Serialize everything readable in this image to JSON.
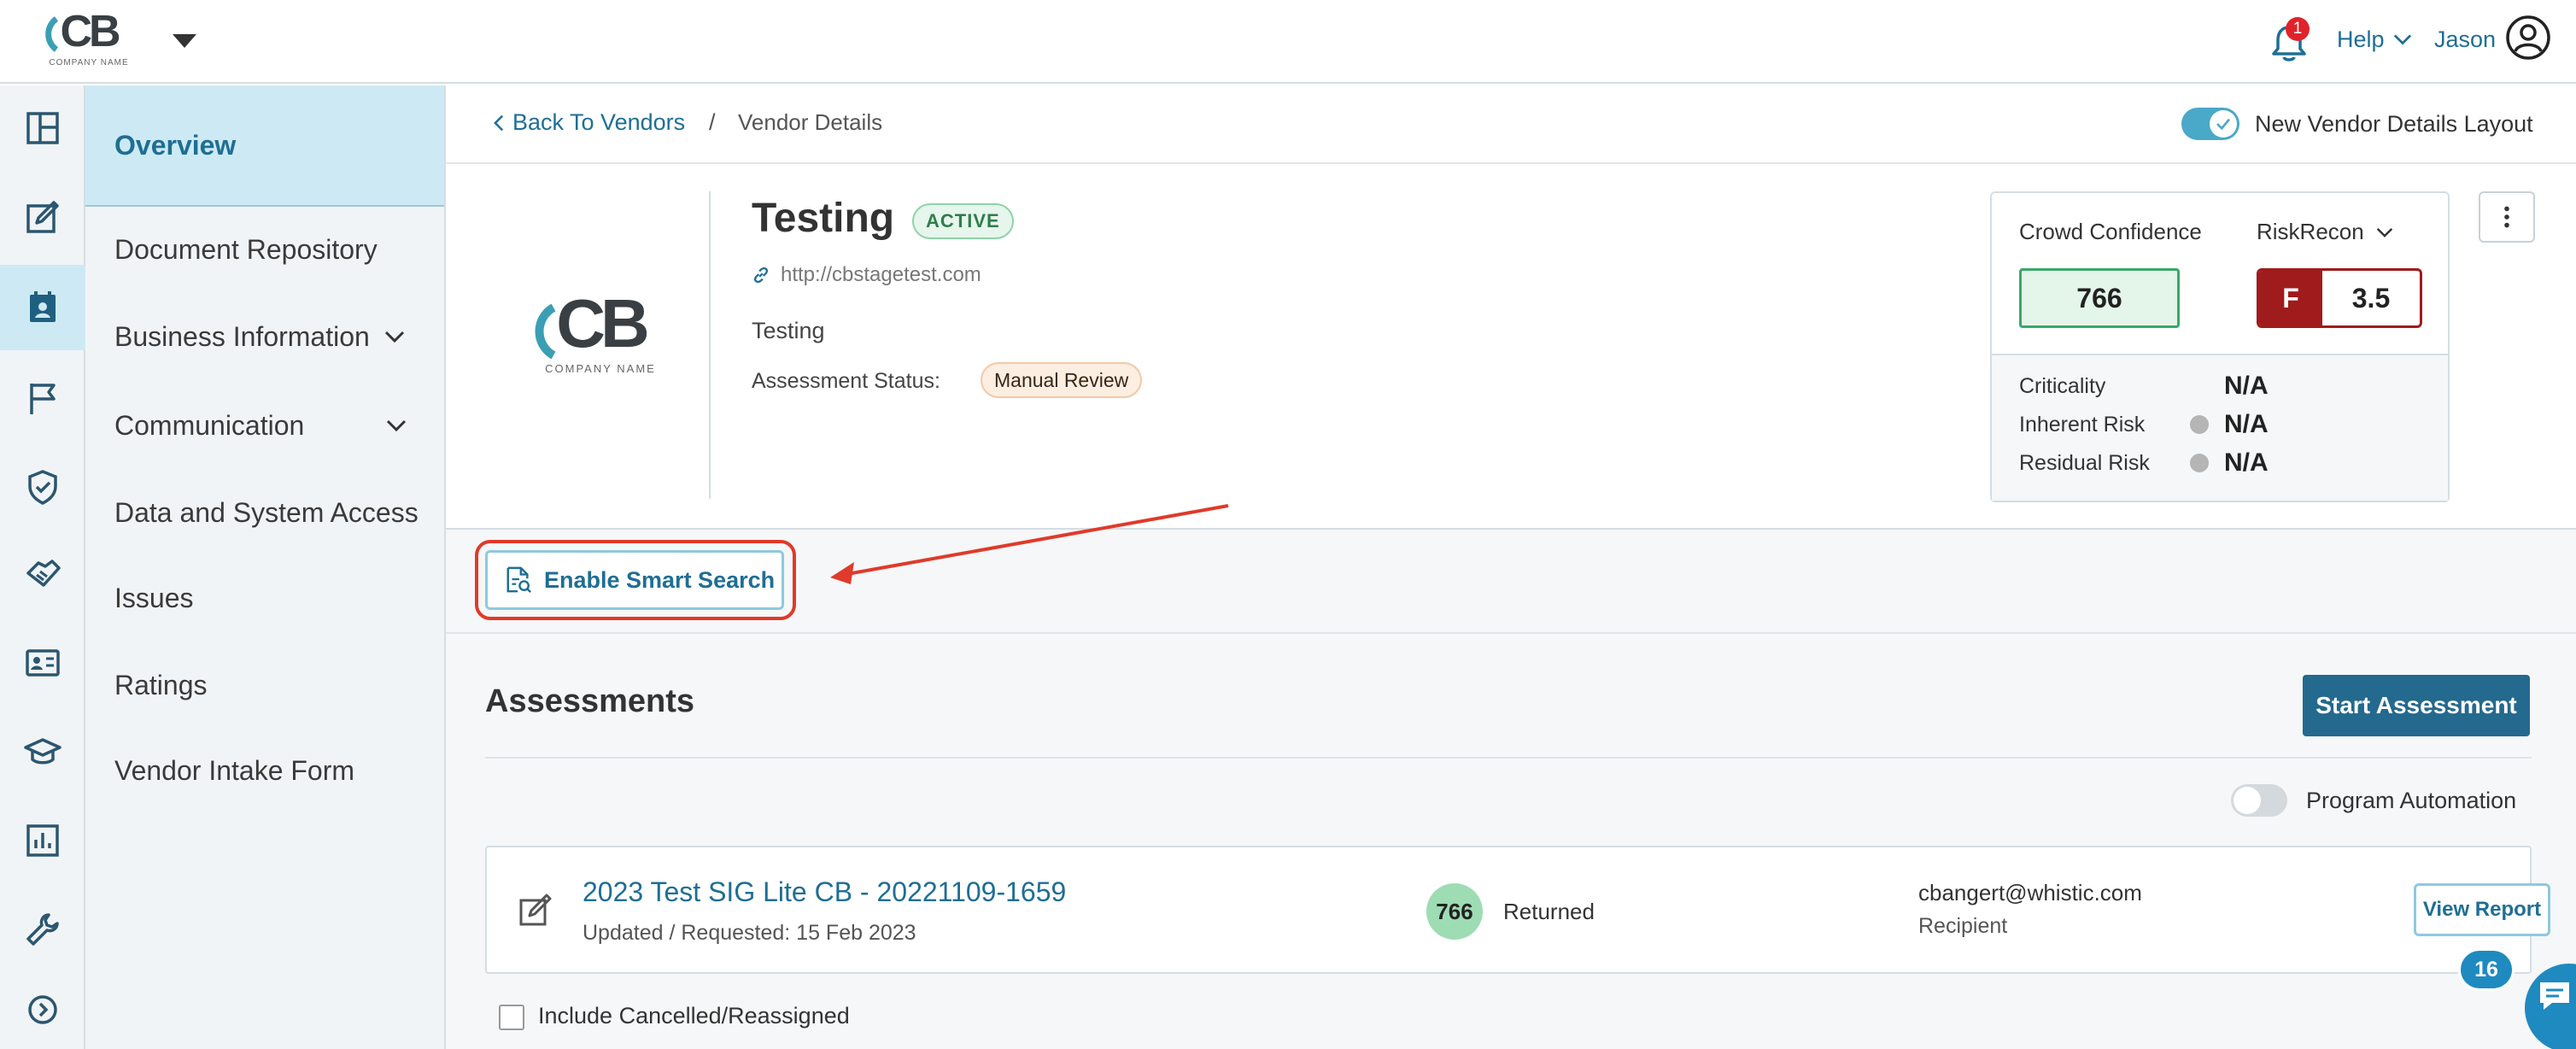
{
  "header": {
    "logo_text": "CB",
    "logo_subtext": "COMPANY NAME",
    "notification_count": "1",
    "help_label": "Help",
    "user_name": "Jason"
  },
  "rail": {
    "icons": [
      "layout-icon",
      "edit-icon",
      "vendors-icon",
      "flag-icon",
      "shield-icon",
      "handshake-icon",
      "id-card-icon",
      "graduation-icon",
      "chart-icon",
      "wrench-icon",
      "expand-icon"
    ],
    "active": "vendors-icon"
  },
  "sidenav": {
    "items": [
      {
        "label": "Overview",
        "active": true
      },
      {
        "label": "Document Repository"
      },
      {
        "label": "Business Information",
        "expandable": true
      },
      {
        "label": "Communication",
        "expandable": true
      },
      {
        "label": "Data and System Access"
      },
      {
        "label": "Issues"
      },
      {
        "label": "Ratings"
      },
      {
        "label": "Vendor Intake Form"
      }
    ]
  },
  "breadcrumb": {
    "back_label": "Back To Vendors",
    "separator": "/",
    "current": "Vendor Details"
  },
  "layout_toggle": {
    "label": "New Vendor Details Layout",
    "on": true
  },
  "vendor": {
    "name": "Testing",
    "status_badge": "ACTIVE",
    "url": "http://cbstagetest.com",
    "description": "Testing",
    "assessment_status_label": "Assessment Status:",
    "assessment_status": "Manual Review",
    "logo_text": "CB",
    "logo_subtext": "COMPANY NAME"
  },
  "scores": {
    "crowd_confidence_label": "Crowd Confidence",
    "crowd_confidence_value": "766",
    "riskrecon_label": "RiskRecon",
    "riskrecon_grade": "F",
    "riskrecon_score": "3.5",
    "criticality_label": "Criticality",
    "criticality_value": "N/A",
    "inherent_risk_label": "Inherent Risk",
    "inherent_risk_value": "N/A",
    "residual_risk_label": "Residual Risk",
    "residual_risk_value": "N/A"
  },
  "smart_search": {
    "label": "Enable Smart Search"
  },
  "assessments": {
    "title": "Assessments",
    "start_label": "Start Assessment",
    "automation_label": "Program Automation",
    "automation_on": false,
    "items": [
      {
        "title": "2023 Test SIG Lite CB - 20221109-1659",
        "subtitle": "Updated / Requested: 15 Feb 2023",
        "score": "766",
        "status": "Returned",
        "email": "cbangert@whistic.com",
        "role": "Recipient",
        "action_label": "View Report"
      }
    ],
    "include_cancelled_label": "Include Cancelled/Reassigned"
  },
  "chat": {
    "badge": "16"
  },
  "colors": {
    "primary": "#1f6e94",
    "accent": "#4aa8c9",
    "active_bg": "#cdeaf4",
    "danger": "#a01b1b",
    "success": "#3aa86a",
    "annotation": "#e03a2a"
  }
}
